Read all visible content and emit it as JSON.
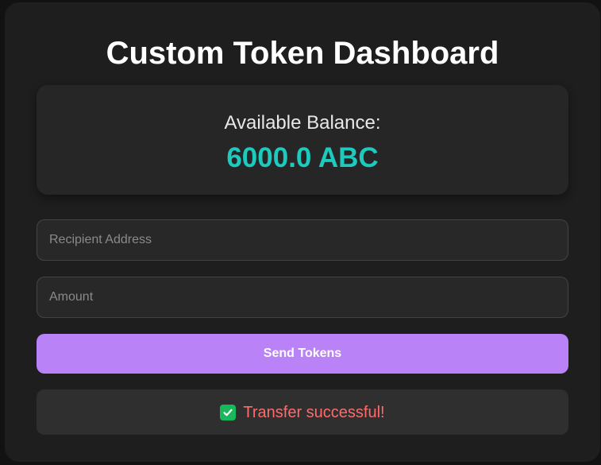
{
  "header": {
    "title": "Custom Token Dashboard"
  },
  "balance": {
    "label": "Available Balance:",
    "value": "6000.0 ABC"
  },
  "form": {
    "recipient_placeholder": "Recipient Address",
    "recipient_value": "",
    "amount_placeholder": "Amount",
    "amount_value": "",
    "send_label": "Send Tokens"
  },
  "status": {
    "icon": "check-icon",
    "message": "Transfer successful!"
  },
  "colors": {
    "background": "#1e1e1e",
    "accent_balance": "#1ec9bd",
    "button": "#b983f7",
    "success_icon": "#18b95b",
    "status_text": "#ff6b6b"
  }
}
